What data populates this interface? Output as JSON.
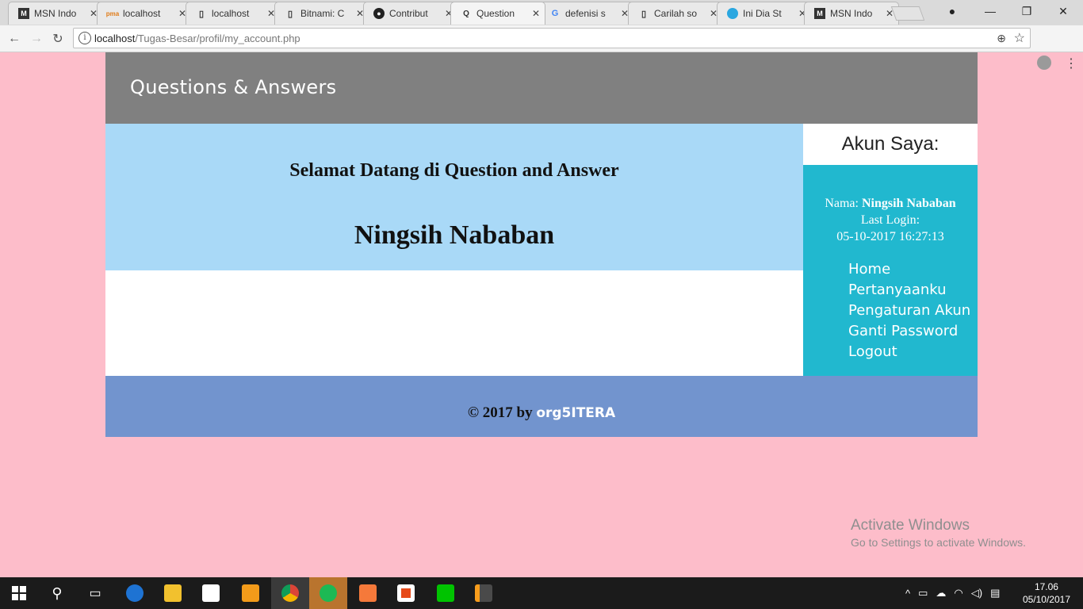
{
  "browser": {
    "tabs": [
      {
        "label": "MSN Indo",
        "icon": "msn-icon",
        "active": false
      },
      {
        "label": "localhost",
        "icon": "phpmyadmin-icon",
        "active": false
      },
      {
        "label": "localhost",
        "icon": "page-icon",
        "active": false
      },
      {
        "label": "Bitnami: C",
        "icon": "page-icon",
        "active": false
      },
      {
        "label": "Contribut",
        "icon": "github-icon",
        "active": false
      },
      {
        "label": "Question",
        "icon": "qa-icon",
        "active": true
      },
      {
        "label": "defenisi s",
        "icon": "google-icon",
        "active": false
      },
      {
        "label": "Carilah so",
        "icon": "page-icon",
        "active": false
      },
      {
        "label": "Ini Dia St",
        "icon": "app-icon",
        "active": false
      },
      {
        "label": "MSN Indo",
        "icon": "msn-icon",
        "active": false
      }
    ],
    "url_host": "localhost",
    "url_path": "/Tugas-Besar/profil/my_account.php"
  },
  "page": {
    "site_title": "Questions & Answers",
    "welcome_heading": "Selamat Datang di Question and Answer",
    "user_display_name": "Ningsih Nababan",
    "sidebar": {
      "title": "Akun Saya:",
      "name_label": "Nama:",
      "name_value": "Ningsih Nababan",
      "last_login_label": "Last Login:",
      "last_login_value": "05-10-2017 16:27:13",
      "nav": [
        "Home",
        "Pertanyaanku",
        "Pengaturan Akun",
        "Ganti Password",
        "Logout"
      ]
    },
    "footer": {
      "prefix": "© 2017 by",
      "org": "org5ITERA"
    }
  },
  "os": {
    "activate_title": "Activate Windows",
    "activate_sub": "Go to Settings to activate Windows.",
    "taskbar_apps": [
      "start-icon",
      "search-icon",
      "task-view-icon",
      "edge-icon",
      "file-explorer-icon",
      "store-icon",
      "uc-browser-icon",
      "chrome-icon",
      "spotify-icon",
      "xampp-icon",
      "office-icon",
      "line-icon",
      "sublime-icon"
    ],
    "clock_time": "17.06",
    "clock_date": "05/10/2017"
  },
  "colors": {
    "background": "#fdbdca",
    "header": "#808080",
    "welcome": "#a9d9f7",
    "sidebar": "#21b8cf",
    "footer": "#7294ce"
  }
}
